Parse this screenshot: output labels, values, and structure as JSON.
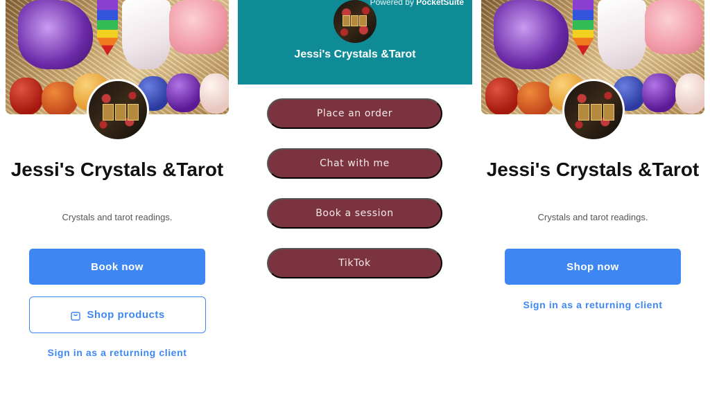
{
  "left_profile": {
    "business_name": "Jessi's Crystals &Tarot",
    "tagline": "Crystals and tarot readings.",
    "primary_button": "Book now",
    "secondary_button": "Shop products",
    "signin_link": "Sign in as a returning client"
  },
  "middle_profile": {
    "powered_by_prefix": "Powered by ",
    "powered_by_brand": "PocketSuite",
    "business_name": "Jessi's Crystals &Tarot",
    "link_buttons": [
      "Place an order",
      "Chat with me",
      "Book a session",
      "TikTok"
    ],
    "header_color": "#0e8b96",
    "button_color": "#7a333f"
  },
  "right_profile": {
    "business_name": "Jessi's Crystals &Tarot",
    "tagline": "Crystals and tarot readings.",
    "primary_button": "Shop now",
    "signin_link": "Sign in as a returning client"
  },
  "icons": {
    "shop_products_icon": "shopping-bag-icon"
  },
  "colors": {
    "accent_blue": "#3e87f2"
  }
}
